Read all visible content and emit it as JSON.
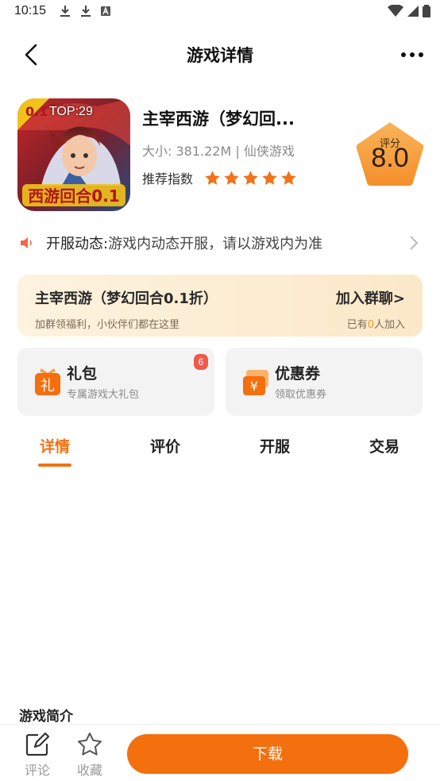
{
  "status_bar": {
    "time": "10:15"
  },
  "nav": {
    "title": "游戏详情"
  },
  "game": {
    "icon_badge": "TOP:29",
    "name": "主宰西游（梦幻回...",
    "meta": "大小: 381.22M | 仙侠游戏",
    "recommend_label": "推荐指数",
    "stars": 5,
    "score_label": "评分",
    "score_value": "8.0"
  },
  "notice": {
    "title": "开服动态:",
    "text": "游戏内动态开服，请以游戏内为准"
  },
  "group": {
    "name": "主宰西游（梦幻回合0.1折）",
    "subtitle": "加群领福利，小伙伴们都在这里",
    "join_label": "加入群聊>",
    "count_prefix": "已有",
    "count_value": "0",
    "count_suffix": "人加入"
  },
  "benefits": {
    "gift": {
      "icon_char": "礼",
      "title": "礼包",
      "subtitle": "专属游戏大礼包",
      "badge": "6"
    },
    "coupon": {
      "icon_char": "¥",
      "title": "优惠券",
      "subtitle": "领取优惠券"
    }
  },
  "tabs": [
    {
      "label": "详情"
    },
    {
      "label": "评价"
    },
    {
      "label": "开服"
    },
    {
      "label": "交易"
    }
  ],
  "intro": {
    "title": "游戏简介"
  },
  "bottom": {
    "comment_label": "评论",
    "favorite_label": "收藏",
    "download_label": "下载"
  },
  "colors": {
    "accent": "#f07214",
    "star": "#f2731a",
    "score_badge": "#f7a343",
    "badge_red": "#f05a4a"
  }
}
